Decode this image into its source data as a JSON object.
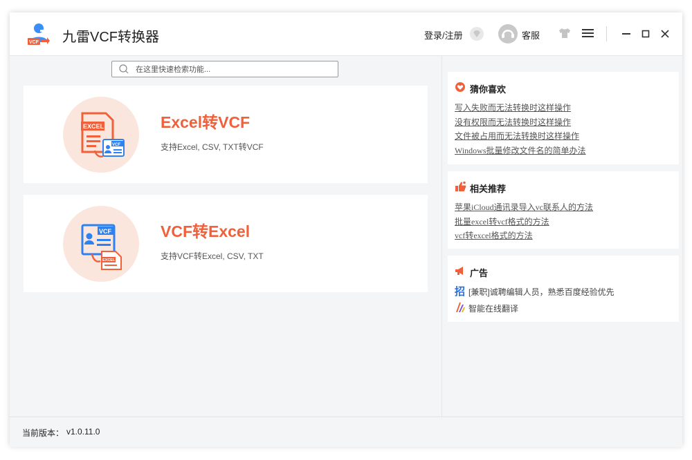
{
  "app": {
    "title": "九雷VCF转换器",
    "accent": "#f0603a"
  },
  "titlebar": {
    "login_label": "登录/注册",
    "service_label": "客服",
    "icons": [
      "app-logo-icon",
      "vip-diamond-icon",
      "customer-service-icon",
      "skin-tshirt-icon",
      "menu-icon",
      "minimize-icon",
      "maximize-icon",
      "close-icon"
    ]
  },
  "search": {
    "placeholder": "在这里快速检索功能..."
  },
  "cards": [
    {
      "title": "Excel转VCF",
      "desc": "支持Excel, CSV, TXT转VCF",
      "icon": "excel-to-vcf-icon"
    },
    {
      "title": "VCF转Excel",
      "desc": "支持VCF转Excel, CSV, TXT",
      "icon": "vcf-to-excel-icon"
    }
  ],
  "sidebar": {
    "guess": {
      "title": "猜你喜欢",
      "links": [
        "写入失败而无法转换时这样操作",
        "没有权限而无法转换时这样操作",
        "文件被占用而无法转换时这样操作",
        "Windows批量修改文件名的简单办法"
      ]
    },
    "recommend": {
      "title": "相关推荐",
      "links": [
        "苹果iCloud通讯录导入vc联系人的方法",
        "批量excel转vcf格式的方法",
        "vcf转excel格式的方法"
      ]
    },
    "ads": {
      "title": "广告",
      "items": [
        {
          "text": "[兼职]诚聘编辑人员，熟悉百度经验优先",
          "icon": "recruit-icon"
        },
        {
          "text": "智能在线翻译",
          "icon": "translate-icon"
        }
      ]
    }
  },
  "footer": {
    "version_label": "当前版本：",
    "version": "v1.0.11.0"
  }
}
